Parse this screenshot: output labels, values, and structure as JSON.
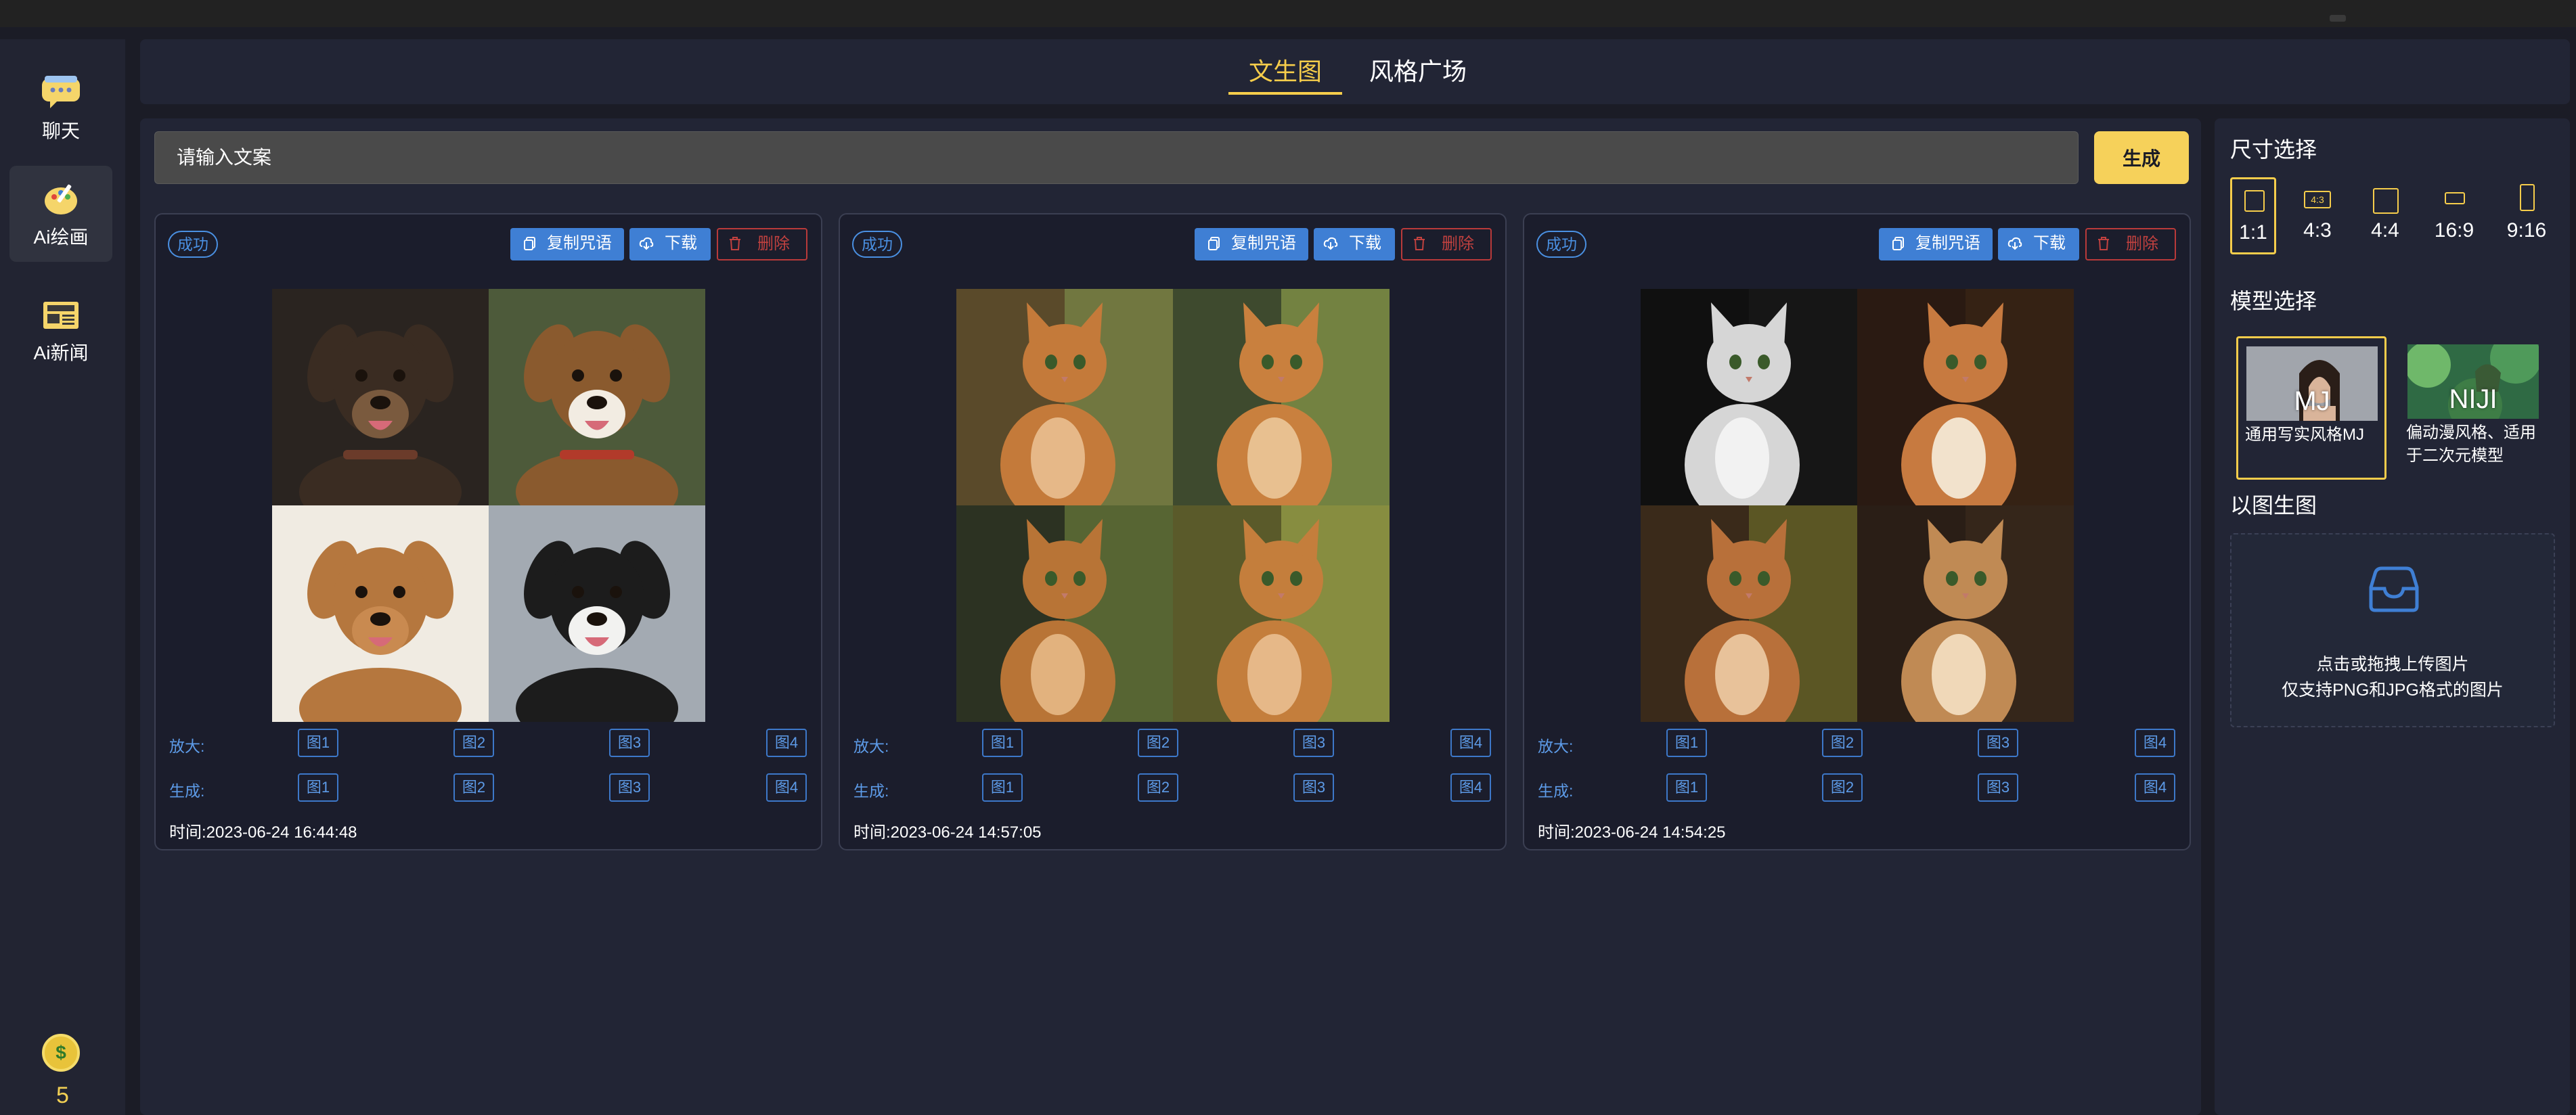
{
  "nav": {
    "items": [
      {
        "label": "聊天",
        "icon": "chat-icon"
      },
      {
        "label": "Ai绘画",
        "icon": "paint-icon"
      },
      {
        "label": "Ai新闻",
        "icon": "news-icon"
      }
    ],
    "credits": "5",
    "coin_icon": "coin-icon",
    "coin_glyph": "$"
  },
  "tabs": [
    {
      "label": "文生图",
      "active": true
    },
    {
      "label": "风格广场",
      "active": false
    }
  ],
  "prompt": {
    "placeholder": "请输入文案",
    "value": ""
  },
  "generate_label": "生成",
  "cards": [
    {
      "status": "成功",
      "copy_label": "复制咒语",
      "download_label": "下载",
      "delete_label": "删除",
      "subject": "dogs",
      "upscale_label": "放大:",
      "variation_label": "生成:",
      "buttons": [
        "图1",
        "图2",
        "图3",
        "图4"
      ],
      "time": "时间:2023-06-24 16:44:48"
    },
    {
      "status": "成功",
      "copy_label": "复制咒语",
      "download_label": "下载",
      "delete_label": "删除",
      "subject": "kittens",
      "upscale_label": "放大:",
      "variation_label": "生成:",
      "buttons": [
        "图1",
        "图2",
        "图3",
        "图4"
      ],
      "time": "时间:2023-06-24 14:57:05"
    },
    {
      "status": "成功",
      "copy_label": "复制咒语",
      "download_label": "下载",
      "delete_label": "删除",
      "subject": "cats",
      "upscale_label": "放大:",
      "variation_label": "生成:",
      "buttons": [
        "图1",
        "图2",
        "图3",
        "图4"
      ],
      "time": "时间:2023-06-24 14:54:25"
    }
  ],
  "right_panel": {
    "size_title": "尺寸选择",
    "sizes": [
      {
        "label": "1:1",
        "selected": true
      },
      {
        "label": "4:3",
        "icon_text": "4:3",
        "selected": false
      },
      {
        "label": "4:4",
        "selected": false
      },
      {
        "label": "16:9",
        "selected": false
      },
      {
        "label": "9:16",
        "selected": false
      }
    ],
    "model_title": "模型选择",
    "models": [
      {
        "tag": "MJ",
        "desc": "通用写实风格MJ",
        "selected": true
      },
      {
        "tag": "NIJI",
        "desc": "偏动漫风格、适用于二次元模型",
        "selected": false
      }
    ],
    "img2img_title": "以图生图",
    "upload_line1": "点击或拖拽上传图片",
    "upload_line2": "仅支持PNG和JPG格式的图片"
  },
  "colors": {
    "accent": "#f6cd4b",
    "primary_button": "#3f7fd4",
    "danger": "#c0413f",
    "background": "#1b1c26",
    "panel": "#222535"
  }
}
